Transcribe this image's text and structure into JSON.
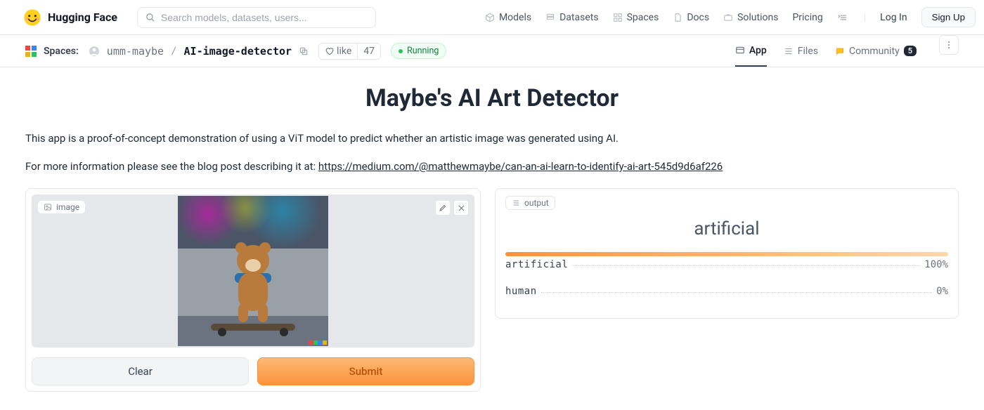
{
  "header": {
    "brand": "Hugging Face",
    "search_placeholder": "Search models, datasets, users...",
    "nav": {
      "models": "Models",
      "datasets": "Datasets",
      "spaces": "Spaces",
      "docs": "Docs",
      "solutions": "Solutions",
      "pricing": "Pricing",
      "login": "Log In",
      "signup": "Sign Up"
    }
  },
  "subheader": {
    "section": "Spaces:",
    "user": "umm-maybe",
    "repo": "AI-image-detector",
    "like_label": "like",
    "like_count": "47",
    "status": "Running",
    "tabs": {
      "app": "App",
      "files": "Files",
      "community": "Community",
      "community_count": "5"
    }
  },
  "app": {
    "title": "Maybe's AI Art Detector",
    "p1": "This app is a proof-of-concept demonstration of using a ViT model to predict whether an artistic image was generated using AI.",
    "p2_prefix": "For more information please see the blog post describing it at: ",
    "p2_link": "https://medium.com/@matthewmaybe/can-an-ai-learn-to-identify-ai-art-545d9d6af226",
    "image_label": "image",
    "output_label": "output",
    "clear": "Clear",
    "submit": "Submit"
  },
  "output": {
    "top_label": "artificial",
    "results": [
      {
        "name": "artificial",
        "pct": "100%",
        "width": "100%"
      },
      {
        "name": "human",
        "pct": "0%",
        "width": "0%"
      }
    ]
  }
}
